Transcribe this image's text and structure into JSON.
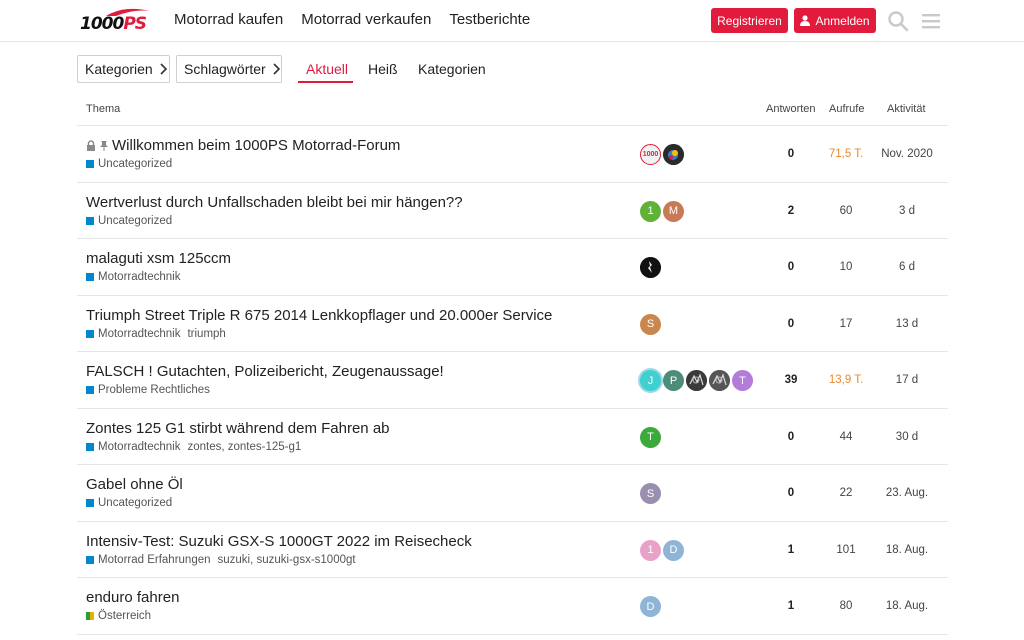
{
  "header": {
    "logo_text": "1000PS",
    "nav": [
      "Motorrad kaufen",
      "Motorrad verkaufen",
      "Testberichte"
    ],
    "register_label": "Registrieren",
    "login_label": "Anmelden",
    "brand_color": "#e21b3c"
  },
  "filters": {
    "categories_label": "Kategorien",
    "tags_label": "Schlagwörter",
    "tabs": [
      "Aktuell",
      "Heiß",
      "Kategorien"
    ],
    "active_tab": "Aktuell"
  },
  "table": {
    "headers": {
      "topic": "Thema",
      "replies": "Antworten",
      "views": "Aufrufe",
      "activity": "Aktivität"
    },
    "rows": [
      {
        "title": "Willkommen beim 1000PS Motorrad-Forum",
        "locked": true,
        "pinned": true,
        "category": "Uncategorized",
        "category_color": "#0088cc",
        "tags": "",
        "avatars": [
          {
            "letter": "",
            "color": "#f2f2f2"
          },
          {
            "letter": "",
            "color": "#2b2b2b"
          }
        ],
        "replies": "0",
        "views": "71,5 T.",
        "views_hot": true,
        "activity": "Nov. 2020"
      },
      {
        "title": "Wertverlust durch Unfallschaden bleibt bei mir hängen??",
        "locked": false,
        "pinned": false,
        "category": "Uncategorized",
        "category_color": "#0088cc",
        "tags": "",
        "avatars": [
          {
            "letter": "1",
            "color": "#5fb236"
          },
          {
            "letter": "M",
            "color": "#c87a55"
          }
        ],
        "replies": "2",
        "views": "60",
        "views_hot": false,
        "activity": "3 d"
      },
      {
        "title": "malaguti xsm 125ccm",
        "locked": false,
        "pinned": false,
        "category": "Motorradtechnik",
        "category_color": "#0088cc",
        "tags": "",
        "avatars": [
          {
            "letter": "",
            "color": "#111111"
          }
        ],
        "replies": "0",
        "views": "10",
        "views_hot": false,
        "activity": "6 d"
      },
      {
        "title": "Triumph Street Triple R 675 2014 Lenkkopflager und 20.000er Service",
        "locked": false,
        "pinned": false,
        "category": "Motorradtechnik",
        "category_color": "#0088cc",
        "tags": "triumph",
        "avatars": [
          {
            "letter": "S",
            "color": "#c9874f"
          }
        ],
        "replies": "0",
        "views": "17",
        "views_hot": false,
        "activity": "13 d"
      },
      {
        "title": "FALSCH ! Gutachten, Polizeibericht, Zeugenaussage!",
        "locked": false,
        "pinned": false,
        "category": "Probleme Rechtliches",
        "category_color": "#0088cc",
        "tags": "",
        "avatars": [
          {
            "letter": "J",
            "color": "#3fd0cf"
          },
          {
            "letter": "P",
            "color": "#4d8c7a"
          },
          {
            "letter": "",
            "color": "#3a3a3a"
          },
          {
            "letter": "",
            "color": "#555555"
          },
          {
            "letter": "T",
            "color": "#b27cd8"
          }
        ],
        "replies": "39",
        "views": "13,9 T.",
        "views_hot": true,
        "activity": "17 d"
      },
      {
        "title": "Zontes 125 G1 stirbt während dem Fahren ab",
        "locked": false,
        "pinned": false,
        "category": "Motorradtechnik",
        "category_color": "#0088cc",
        "tags": "zontes, zontes-125-g1",
        "avatars": [
          {
            "letter": "T",
            "color": "#3aaa3a"
          }
        ],
        "replies": "0",
        "views": "44",
        "views_hot": false,
        "activity": "30 d"
      },
      {
        "title": "Gabel ohne Öl",
        "locked": false,
        "pinned": false,
        "category": "Uncategorized",
        "category_color": "#0088cc",
        "tags": "",
        "avatars": [
          {
            "letter": "S",
            "color": "#9a8fb0"
          }
        ],
        "replies": "0",
        "views": "22",
        "views_hot": false,
        "activity": "23. Aug."
      },
      {
        "title": "Intensiv-Test: Suzuki GSX-S 1000GT 2022 im Reisecheck",
        "locked": false,
        "pinned": false,
        "category": "Motorrad Erfahrungen",
        "category_color": "#0088cc",
        "tags": "suzuki, suzuki-gsx-s1000gt",
        "avatars": [
          {
            "letter": "1",
            "color": "#e8a2c8"
          },
          {
            "letter": "D",
            "color": "#8fb4d6"
          }
        ],
        "replies": "1",
        "views": "101",
        "views_hot": false,
        "activity": "18. Aug."
      },
      {
        "title": "enduro fahren",
        "locked": false,
        "pinned": false,
        "category": "Österreich",
        "category_color": "#e0b400",
        "tags": "",
        "avatars": [
          {
            "letter": "D",
            "color": "#8fb4d6"
          }
        ],
        "replies": "1",
        "views": "80",
        "views_hot": false,
        "activity": "18. Aug."
      }
    ]
  }
}
